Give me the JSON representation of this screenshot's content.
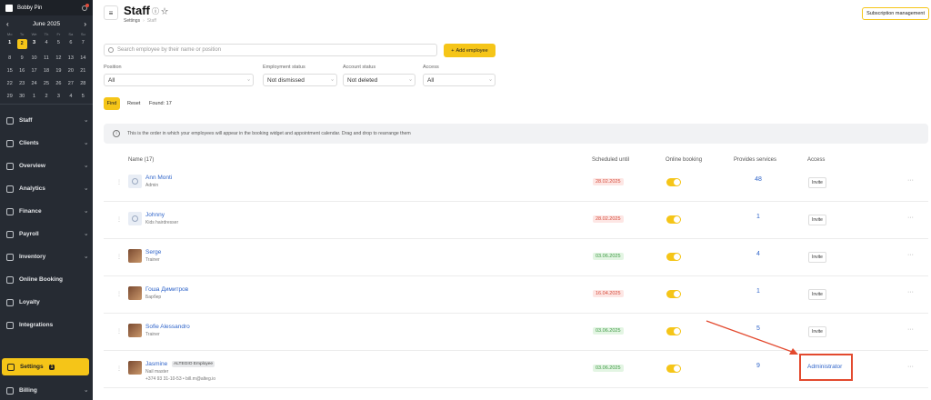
{
  "user": {
    "name": "Bobby Pin"
  },
  "calendar": {
    "prev": "‹",
    "next": "›",
    "month": "June 2025",
    "weekdays": [
      "Mo",
      "Tu",
      "We",
      "Th",
      "Fr",
      "Sa",
      "Su"
    ],
    "weeks": [
      [
        "1",
        "2",
        "3",
        "4",
        "5",
        "6",
        "7"
      ],
      [
        "8",
        "9",
        "10",
        "11",
        "12",
        "13",
        "14"
      ],
      [
        "15",
        "16",
        "17",
        "18",
        "19",
        "20",
        "21"
      ],
      [
        "22",
        "23",
        "24",
        "25",
        "26",
        "27",
        "28"
      ],
      [
        "29",
        "30",
        "1",
        "2",
        "3",
        "4",
        "5"
      ]
    ]
  },
  "nav": {
    "items": [
      {
        "label": "Staff",
        "icon": "user-icon",
        "chevron": "›"
      },
      {
        "label": "Clients",
        "icon": "clients-icon",
        "chevron": "›"
      },
      {
        "label": "Overview",
        "icon": "overview-icon",
        "chevron": "›"
      },
      {
        "label": "Analytics",
        "icon": "analytics-icon",
        "chevron": "›"
      },
      {
        "label": "Finance",
        "icon": "finance-icon",
        "chevron": "›"
      },
      {
        "label": "Payroll",
        "icon": "payroll-icon",
        "chevron": "›"
      },
      {
        "label": "Inventory",
        "icon": "inventory-icon",
        "chevron": "›"
      },
      {
        "label": "Online Booking",
        "icon": "booking-icon",
        "chevron": ""
      },
      {
        "label": "Loyalty",
        "icon": "loyalty-icon",
        "chevron": ""
      },
      {
        "label": "Integrations",
        "icon": "integrations-icon",
        "chevron": ""
      }
    ],
    "settings": {
      "label": "Settings",
      "badge": "1"
    },
    "billing": {
      "label": "Billing",
      "chevron": "›"
    }
  },
  "header": {
    "menu_glyph": "≡",
    "title": "Staff",
    "title_icons": "ⓘ☆",
    "breadcrumb_parent": "Settings",
    "breadcrumb_sep": "›",
    "breadcrumb_current": "Staff",
    "subscription_button": "Subscription management"
  },
  "search": {
    "placeholder": "Search employee by their name or position"
  },
  "add_employee": {
    "plus": "+",
    "label": "Add employee"
  },
  "filters": [
    {
      "label": "Position",
      "value": "All"
    },
    {
      "label": "Employment status",
      "value": "Not dismissed"
    },
    {
      "label": "Account status",
      "value": "Not deleted"
    },
    {
      "label": "Access",
      "value": "All"
    }
  ],
  "filter_chevron": "›",
  "actions": {
    "find": "Find",
    "reset": "Reset",
    "found": "Found: 17"
  },
  "info": {
    "icon": "i",
    "text": "This is the order in which your employees will appear in the booking widget and appointment calendar. Drag and drop to rearrange them"
  },
  "table": {
    "headers": {
      "name": "Name (17)",
      "scheduled": "Scheduled until",
      "online": "Online booking",
      "services": "Provides services",
      "access": "Access"
    },
    "drag_glyph": "⋮",
    "more_glyph": "···",
    "rows": [
      {
        "name": "Ann Monti",
        "role": "Admin",
        "scheduled": "28.02.2025",
        "date_status": "red",
        "services": "48",
        "access": "Invite",
        "avatar": "placeholder"
      },
      {
        "name": "Johnny",
        "role": "Kids hairdresser",
        "scheduled": "28.02.2025",
        "date_status": "red",
        "services": "1",
        "access": "Invite",
        "avatar": "placeholder"
      },
      {
        "name": "Serge",
        "role": "Trainer",
        "scheduled": "03.06.2025",
        "date_status": "green",
        "services": "4",
        "access": "Invite",
        "avatar": "photo"
      },
      {
        "name": "Гоша Димитров",
        "role": "Барбер",
        "scheduled": "16.04.2025",
        "date_status": "red",
        "services": "1",
        "access": "Invite",
        "avatar": "photo"
      },
      {
        "name": "Sofie Alessandro",
        "role": "Trainer",
        "scheduled": "03.06.2025",
        "date_status": "green",
        "services": "5",
        "access": "Invite",
        "avatar": "photo"
      },
      {
        "name": "Jasmine",
        "tag": "ALTEGIO Employee",
        "role": "Nail master",
        "contact": "+374 93 31-10-53 • bill.m@alteg.io",
        "scheduled": "03.06.2025",
        "date_status": "green",
        "services": "9",
        "access": "Administrator",
        "avatar": "photo"
      }
    ]
  },
  "colors": {
    "accent": "#f5c518",
    "link": "#2f64c9",
    "sidebar": "#262b33",
    "annotation": "#e34a2f"
  }
}
